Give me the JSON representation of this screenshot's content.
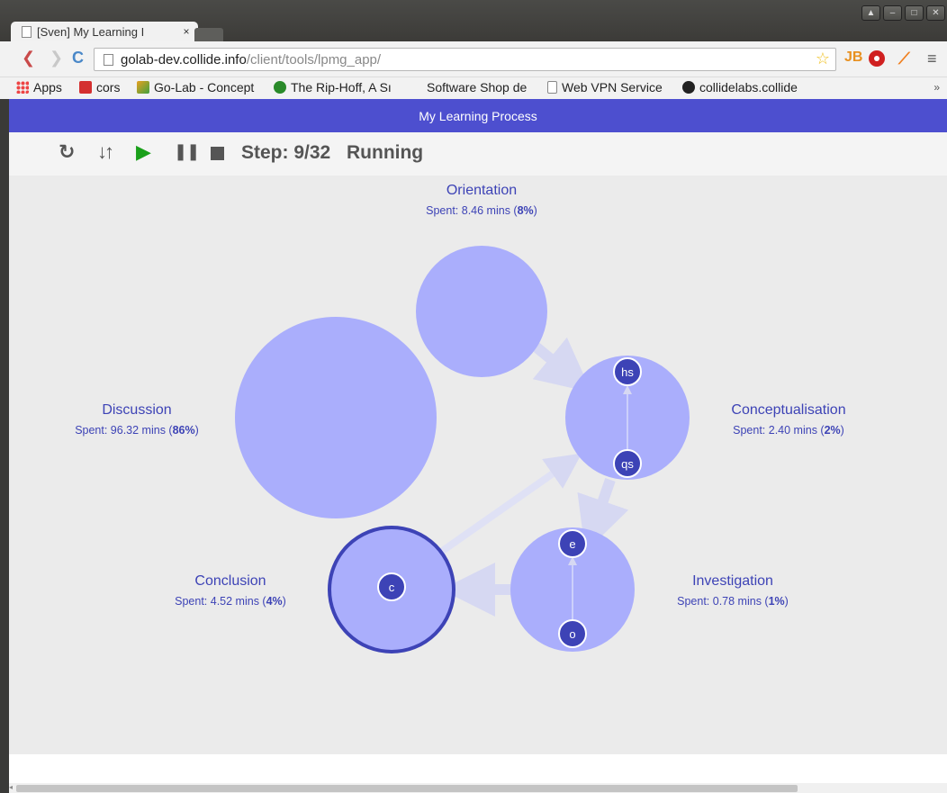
{
  "browser": {
    "tab_title": "[Sven] My Learning I",
    "tab_close": "×",
    "url_host": "golab-dev.collide.info",
    "url_path": "/client/tools/lpmg_app/",
    "bookmarks": [
      {
        "label": "Apps"
      },
      {
        "label": "cors"
      },
      {
        "label": "Go-Lab - Concept"
      },
      {
        "label": "The Rip-Hoff, A Sı"
      },
      {
        "label": "Software Shop de"
      },
      {
        "label": "Web VPN Service"
      },
      {
        "label": "collidelabs.collide"
      }
    ],
    "bookmarks_more": "»",
    "icons": {
      "back": "back-icon",
      "forward": "forward-icon",
      "reload": "reload-icon",
      "star": "star-icon",
      "menu": "menu-icon"
    }
  },
  "app": {
    "title": "My Learning Process",
    "step_label": "Step: 9/32",
    "status": "Running",
    "controls": [
      "reset-icon",
      "sort-icon",
      "play-icon",
      "pause-icon",
      "stop-icon"
    ],
    "accent_color": "#4d4fcf",
    "node_fill": "#aaaefc",
    "node_dark": "#3d43b6"
  },
  "phases": [
    {
      "name": "Orientation",
      "spent_prefix": "Spent: 8.46 mins (",
      "percent": "8%",
      "spent_suffix": ")"
    },
    {
      "name": "Conceptualisation",
      "spent_prefix": "Spent: 2.40 mins (",
      "percent": "2%",
      "spent_suffix": ")"
    },
    {
      "name": "Investigation",
      "spent_prefix": "Spent: 0.78 mins (",
      "percent": "1%",
      "spent_suffix": ")"
    },
    {
      "name": "Conclusion",
      "spent_prefix": "Spent: 4.52 mins (",
      "percent": "4%",
      "spent_suffix": ")"
    },
    {
      "name": "Discussion",
      "spent_prefix": "Spent: 96.32 mins (",
      "percent": "86%",
      "spent_suffix": ")"
    }
  ],
  "subphases": {
    "hs": "hs",
    "qs": "qs",
    "e": "e",
    "o": "o",
    "c": "c"
  }
}
